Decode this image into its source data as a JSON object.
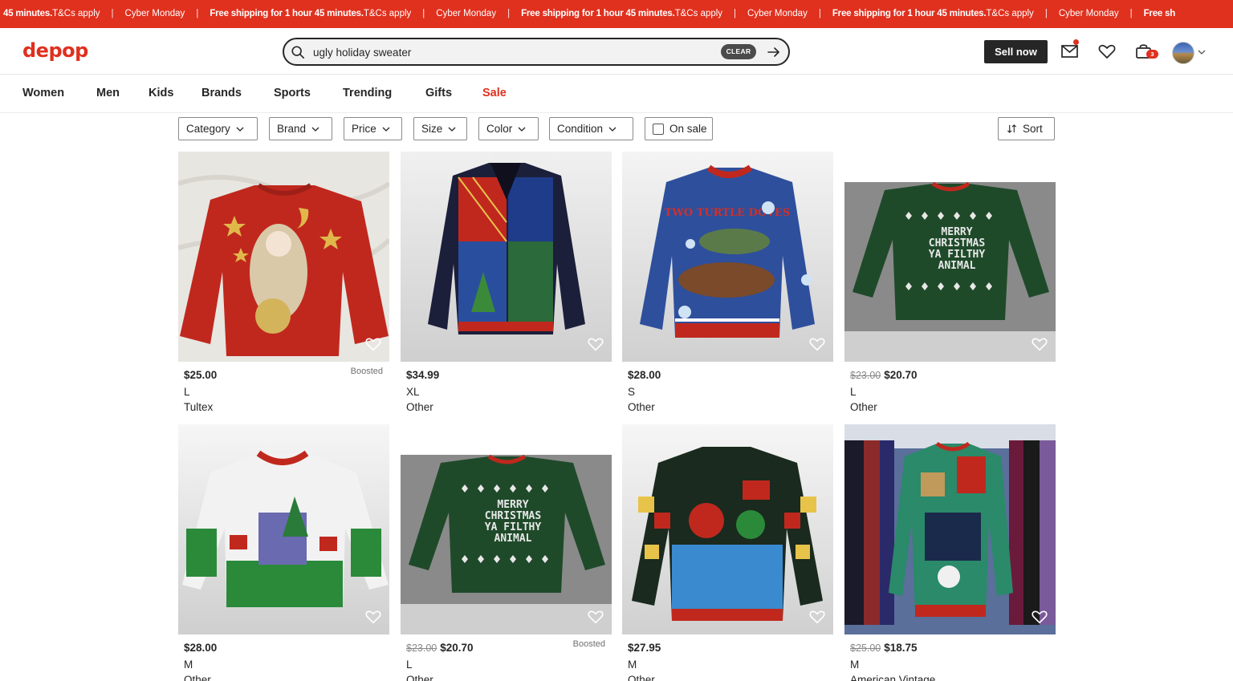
{
  "promo": {
    "items": [
      {
        "strong": "45 minutes.",
        "text": " T&Cs apply"
      },
      {
        "strong": "",
        "text": "Cyber Monday"
      },
      {
        "strong": "Free shipping for 1 hour 45 minutes.",
        "text": " T&Cs apply"
      },
      {
        "strong": "",
        "text": "Cyber Monday"
      },
      {
        "strong": "Free shipping for 1 hour 45 minutes.",
        "text": " T&Cs apply"
      },
      {
        "strong": "",
        "text": "Cyber Monday"
      },
      {
        "strong": "Free shipping for 1 hour 45 minutes.",
        "text": " T&Cs apply"
      },
      {
        "strong": "",
        "text": "Cyber Monday"
      },
      {
        "strong": "Free sh",
        "text": ""
      }
    ],
    "separator": "|"
  },
  "header": {
    "logo": "depop",
    "search_value": "ugly holiday sweater",
    "clear_label": "CLEAR",
    "sell_label": "Sell now",
    "bag_count": "3"
  },
  "nav": {
    "items": [
      "Women",
      "Men",
      "Kids",
      "Brands",
      "Sports",
      "Trending",
      "Gifts",
      "Sale"
    ]
  },
  "filters": {
    "items": [
      "Category",
      "Brand",
      "Price",
      "Size",
      "Color",
      "Condition"
    ],
    "on_sale_label": "On sale",
    "sort_label": "Sort"
  },
  "products": [
    {
      "price": "$25.00",
      "old_price": "",
      "size": "L",
      "brand": "Tultex",
      "boosted": "Boosted"
    },
    {
      "price": "$34.99",
      "old_price": "",
      "size": "XL",
      "brand": "Other",
      "boosted": ""
    },
    {
      "price": "$28.00",
      "old_price": "",
      "size": "S",
      "brand": "Other",
      "boosted": ""
    },
    {
      "price": "$20.70",
      "old_price": "$23.00",
      "size": "L",
      "brand": "Other",
      "boosted": ""
    },
    {
      "price": "$28.00",
      "old_price": "",
      "size": "M",
      "brand": "Other",
      "boosted": ""
    },
    {
      "price": "$20.70",
      "old_price": "$23.00",
      "size": "L",
      "brand": "Other",
      "boosted": "Boosted"
    },
    {
      "price": "$27.95",
      "old_price": "",
      "size": "M",
      "brand": "Other",
      "boosted": ""
    },
    {
      "price": "$18.75",
      "old_price": "$25.00",
      "size": "M",
      "brand": "American Vintage",
      "boosted": ""
    }
  ],
  "sweater_text": {
    "turtle": "TWO TURTLE DOVES",
    "animal": "MERRY CHRISTMAS YA FILTHY ANIMAL"
  },
  "colors": {
    "brand": "#e0301e",
    "dark": "#262626"
  }
}
